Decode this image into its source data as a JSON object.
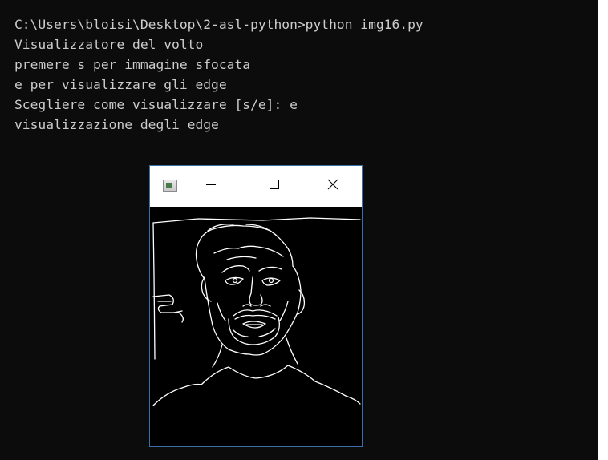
{
  "console": {
    "background": "#0c0c0c",
    "text_color": "#cccccc",
    "lines": [
      "C:\\Users\\bloisi\\Desktop\\2-asl-python>python img16.py",
      "Visualizzatore del volto",
      "premere s per immagine sfocata",
      "e per visualizzare gli edge",
      "Scegliere come visualizzare [s/e]: e",
      "visualizzazione degli edge"
    ]
  },
  "image_window": {
    "border_color": "#3b6fa8",
    "icons": {
      "app": "app-window-icon",
      "minimize": "minimize-icon",
      "maximize": "maximize-icon",
      "close": "close-icon"
    },
    "content": "edge-detected-face-image"
  }
}
